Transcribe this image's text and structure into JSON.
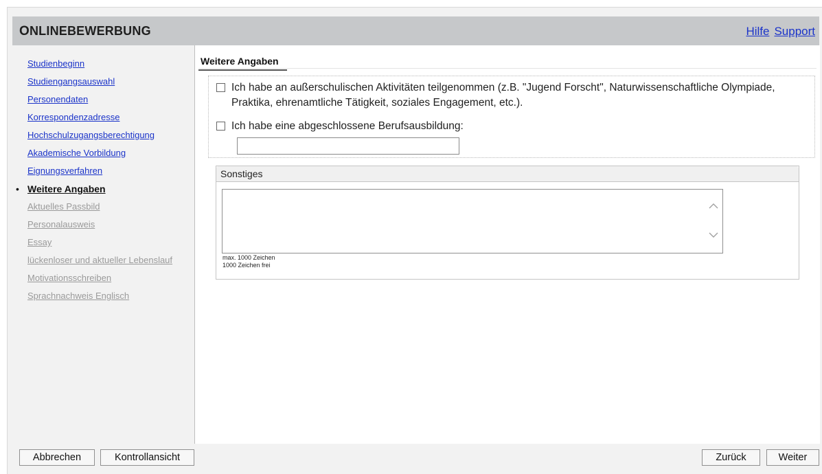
{
  "header": {
    "title_first": "O",
    "title_rest": "NLINEBEWERBUNG",
    "links": [
      "Hilfe",
      "Support"
    ]
  },
  "sidebar": {
    "items": [
      {
        "label": "Studienbeginn",
        "state": "done"
      },
      {
        "label": "Studiengangsauswahl",
        "state": "done"
      },
      {
        "label": "Personendaten",
        "state": "done"
      },
      {
        "label": "Korrespondenzadresse",
        "state": "done"
      },
      {
        "label": "Hochschulzugangsberechtigung",
        "state": "done"
      },
      {
        "label": "Akademische Vorbildung",
        "state": "done"
      },
      {
        "label": "Eignungsverfahren",
        "state": "done"
      },
      {
        "label": "Weitere Angaben",
        "state": "active"
      },
      {
        "label": "Aktuelles Passbild",
        "state": "todo"
      },
      {
        "label": "Personalausweis",
        "state": "todo"
      },
      {
        "label": "Essay",
        "state": "todo"
      },
      {
        "label": "lückenloser und aktueller Lebenslauf",
        "state": "todo"
      },
      {
        "label": "Motivationsschreiben",
        "state": "todo"
      },
      {
        "label": "Sprachnachweis Englisch",
        "state": "todo"
      }
    ]
  },
  "main": {
    "section_title": "Weitere Angaben",
    "checkbox_activities_label": "Ich habe an außerschulischen Aktivitäten teilgenommen (z.B. \"Jugend Forscht\", Naturwissenschaftliche Olympiade, Praktika, ehrenamtliche Tätigkeit, soziales Engagement, etc.).",
    "checkbox_activities_checked": false,
    "checkbox_beruf_label": "Ich habe eine abgeschlossene Berufsausbildung:",
    "checkbox_beruf_checked": false,
    "beruf_value": "",
    "sonstiges": {
      "title": "Sonstiges",
      "value": "",
      "max_hint": "max. 1000 Zeichen",
      "free_hint": "1000 Zeichen frei"
    }
  },
  "footer": {
    "cancel_label": "Abbrechen",
    "review_label": "Kontrollansicht",
    "back_label": "Zurück",
    "next_label": "Weiter"
  },
  "colors": {
    "header_bg": "#c6c8ca",
    "link": "#1a33c9",
    "disabled_link": "#9a9a9a"
  }
}
